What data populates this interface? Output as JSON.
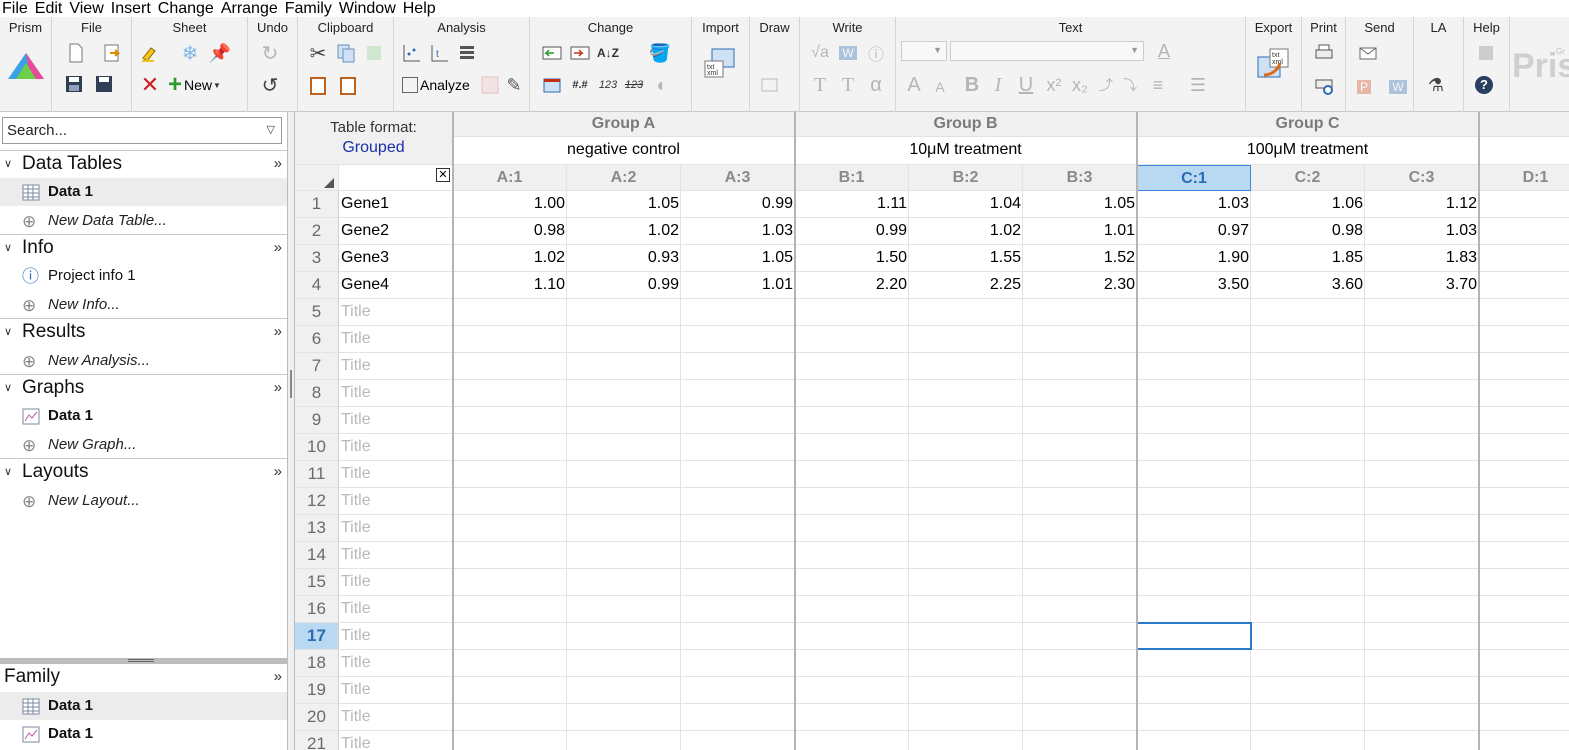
{
  "menu": [
    "File",
    "Edit",
    "View",
    "Insert",
    "Change",
    "Arrange",
    "Family",
    "Window",
    "Help"
  ],
  "ribbon": {
    "groups": {
      "prism": "Prism",
      "file": "File",
      "sheet": "Sheet",
      "undo": "Undo",
      "clipboard": "Clipboard",
      "analysis": "Analysis",
      "change": "Change",
      "import": "Import",
      "draw": "Draw",
      "write": "Write",
      "text": "Text",
      "export": "Export",
      "print": "Print",
      "send": "Send",
      "la": "LA",
      "help": "Help"
    },
    "new_label": "New",
    "analyze_label": "Analyze",
    "brand_text": "Pris",
    "brand_small": "Gr"
  },
  "navigator": {
    "search_placeholder": "Search...",
    "sections": [
      {
        "label": "Data Tables",
        "items": [
          {
            "label": "Data 1"
          },
          {
            "label": "New Data Table..."
          }
        ]
      },
      {
        "label": "Info",
        "items": [
          {
            "label": "Project info 1"
          },
          {
            "label": "New Info..."
          }
        ]
      },
      {
        "label": "Results",
        "items": [
          {
            "label": "New Analysis..."
          }
        ]
      },
      {
        "label": "Graphs",
        "items": [
          {
            "label": "Data 1"
          },
          {
            "label": "New Graph..."
          }
        ]
      },
      {
        "label": "Layouts",
        "items": [
          {
            "label": "New Layout..."
          }
        ]
      }
    ],
    "family": {
      "label": "Family",
      "items": [
        {
          "label": "Data 1"
        },
        {
          "label": "Data 1"
        }
      ]
    }
  },
  "table": {
    "format_label": "Table format:",
    "format_value": "Grouped",
    "groups": [
      {
        "title": "Group A",
        "name": "negative control",
        "columns": [
          "A:1",
          "A:2",
          "A:3"
        ]
      },
      {
        "title": "Group B",
        "name": "10μM treatment",
        "columns": [
          "B:1",
          "B:2",
          "B:3"
        ]
      },
      {
        "title": "Group C",
        "name": "100μM treatment",
        "columns": [
          "C:1",
          "C:2",
          "C:3"
        ]
      }
    ],
    "next_column": "D:1",
    "rows": [
      {
        "num": "1",
        "title": "Gene1",
        "values": [
          "1.00",
          "1.05",
          "0.99",
          "1.11",
          "1.04",
          "1.05",
          "1.03",
          "1.06",
          "1.12"
        ]
      },
      {
        "num": "2",
        "title": "Gene2",
        "values": [
          "0.98",
          "1.02",
          "1.03",
          "0.99",
          "1.02",
          "1.01",
          "0.97",
          "0.98",
          "1.03"
        ]
      },
      {
        "num": "3",
        "title": "Gene3",
        "values": [
          "1.02",
          "0.93",
          "1.05",
          "1.50",
          "1.55",
          "1.52",
          "1.90",
          "1.85",
          "1.83"
        ]
      },
      {
        "num": "4",
        "title": "Gene4",
        "values": [
          "1.10",
          "0.99",
          "1.01",
          "2.20",
          "2.25",
          "2.30",
          "3.50",
          "3.60",
          "3.70"
        ]
      }
    ],
    "empty_rows": [
      "5",
      "6",
      "7",
      "8",
      "9",
      "10",
      "11",
      "12",
      "13",
      "14",
      "15",
      "16",
      "17",
      "18",
      "19",
      "20",
      "21"
    ],
    "title_placeholder": "Title",
    "selected_column": "C:1",
    "selected_row": "17"
  }
}
